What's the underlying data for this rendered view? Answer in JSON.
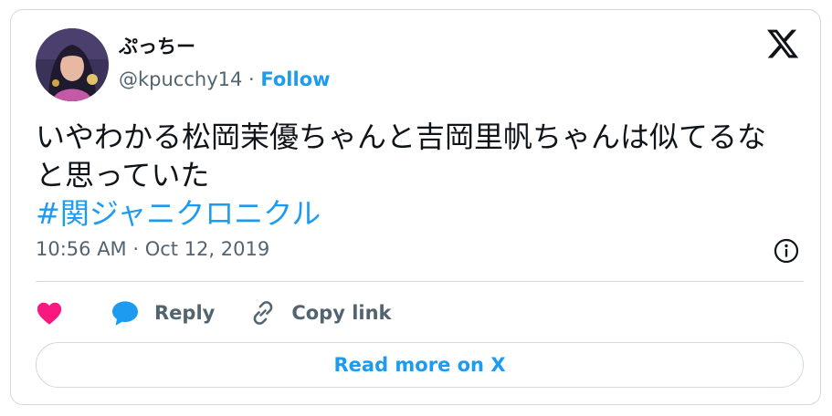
{
  "author": {
    "display_name": "ぷっちー",
    "handle": "@kpucchy14",
    "separator": " · ",
    "follow_label": "Follow"
  },
  "tweet": {
    "text_lines": [
      "いやわかる松岡茉優ちゃんと吉岡里帆ちゃんは似てるな",
      "と思っていた"
    ],
    "hashtag": "#関ジャニクロニクル",
    "timestamp": "10:56 AM · Oct 12, 2019"
  },
  "actions": {
    "reply_label": "Reply",
    "copy_label": "Copy link"
  },
  "read_more_label": "Read more on X",
  "icons": {
    "logo": "x-logo-icon",
    "info": "info-icon",
    "like": "heart-icon",
    "reply": "speech-bubble-icon",
    "copy": "link-icon"
  },
  "colors": {
    "accent": "#1d9bf0",
    "like": "#f91880",
    "text": "#0f1419",
    "muted": "#536471",
    "border": "#cfd9de"
  }
}
